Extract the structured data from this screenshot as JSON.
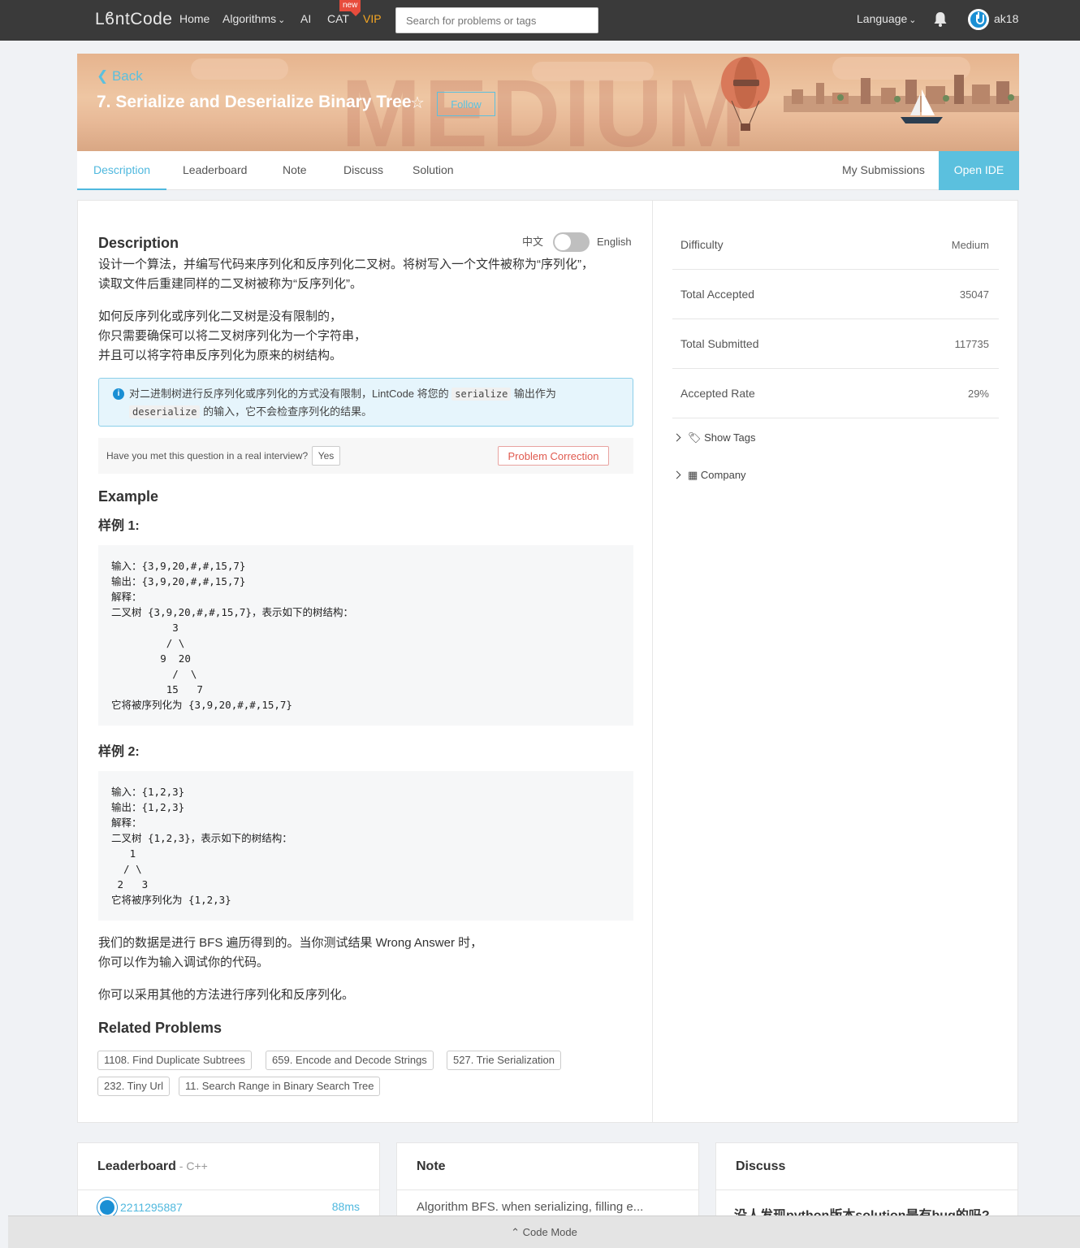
{
  "nav": {
    "logo": "LϐntCode",
    "items": [
      {
        "label": "Home"
      },
      {
        "label": "Algorithms"
      },
      {
        "label": "AI"
      },
      {
        "label": "CAT"
      },
      {
        "label": "VIP"
      }
    ],
    "new_badge": "new",
    "search_placeholder": "Search for problems or tags",
    "language": "Language",
    "username": "ak18",
    "icons": {
      "bell": "bell-icon",
      "avatar": "power-avatar-icon"
    }
  },
  "banner": {
    "back_label": "Back",
    "title": "7. Serialize and Deserialize Binary Tree",
    "follow_label": "Follow",
    "watermark": "MEDIUM",
    "colors": {
      "accent": "#5bc0de"
    }
  },
  "tabs": {
    "items": [
      {
        "label": "Description"
      },
      {
        "label": "Leaderboard"
      },
      {
        "label": "Note"
      },
      {
        "label": "Discuss"
      },
      {
        "label": "Solution"
      }
    ],
    "active": "Description",
    "my_submissions": "My Submissions",
    "open_ide": "Open IDE"
  },
  "description": {
    "heading": "Description",
    "lang_zh": "中文",
    "lang_en": "English",
    "para1_line1": "设计一个算法，并编写代码来序列化和反序列化二叉树。将树写入一个文件被称为“序列化”，",
    "para1_line2": "读取文件后重建同样的二叉树被称为“反序列化”。",
    "para2_line1": "如何反序列化或序列化二叉树是没有限制的，",
    "para2_line2": "你只需要确保可以将二叉树序列化为一个字符串，",
    "para2_line3": "并且可以将字符串反序列化为原来的树结构。",
    "info_part1": "对二进制树进行反序列化或序列化的方式没有限制，LintCode 将您的 ",
    "info_code1": "serialize",
    "info_part2": " 输出作为",
    "info_code2": "deserialize",
    "info_part3": " 的输入，它不会检查序列化的结果。",
    "interview_question": "Have you met this question in a real interview?",
    "yes_label": "Yes",
    "correction_label": "Problem Correction",
    "example_heading": "Example",
    "sample1_title": "样例 1:",
    "sample1_code": "输入：{3,9,20,#,#,15,7}\n输出：{3,9,20,#,#,15,7}\n解释：\n二叉树 {3,9,20,#,#,15,7}，表示如下的树结构：\n\t  3\n\t / \\\n\t9  20\n\t  /  \\\n\t 15   7\n它将被序列化为 {3,9,20,#,#,15,7}",
    "sample2_title": "样例 2:",
    "sample2_code": "输入：{1,2,3}\n输出：{1,2,3}\n解释：\n二叉树 {1,2,3}，表示如下的树结构：\n   1\n  / \\\n 2   3\n它将被序列化为 {1,2,3}",
    "para3_line1": "我们的数据是进行 BFS 遍历得到的。当你测试结果 Wrong Answer 时，",
    "para3_line2": "你可以作为输入调试你的代码。",
    "para4": "你可以采用其他的方法进行序列化和反序列化。",
    "related_heading": "Related Problems",
    "related": [
      "1108. Find Duplicate Subtrees",
      "659. Encode and Decode Strings",
      "527. Trie Serialization",
      "232. Tiny Url",
      "11. Search Range in Binary Search Tree"
    ]
  },
  "stats": {
    "rows": [
      {
        "label": "Difficulty",
        "value": "Medium"
      },
      {
        "label": "Total Accepted",
        "value": "35047"
      },
      {
        "label": "Total Submitted",
        "value": "117735"
      },
      {
        "label": "Accepted Rate",
        "value": "29%"
      }
    ],
    "show_tags": "Show Tags",
    "company": "Company"
  },
  "cards": {
    "leaderboard_title": "Leaderboard",
    "leaderboard_sub": " - C++",
    "leaderboard_user": "2211295887",
    "leaderboard_time": "88ms",
    "note_title": "Note",
    "note_text": "Algorithm BFS. when serializing, filling e...",
    "discuss_title": "Discuss",
    "discuss_text": "没人发现python版本solution是有bug的吗?"
  },
  "footer": {
    "code_mode": "Code Mode"
  }
}
